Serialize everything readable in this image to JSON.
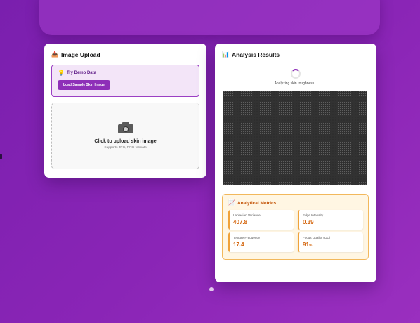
{
  "upload": {
    "title": "Image Upload",
    "title_icon": "upload-tray-icon",
    "demo": {
      "title": "Try Demo Data",
      "title_icon": "lightbulb-icon",
      "button_label": "Load Sample Skin Image"
    },
    "dropzone": {
      "icon": "camera-icon",
      "title": "Click to upload skin image",
      "subtitle": "Supports JPG, PNG formats"
    }
  },
  "results": {
    "title": "Analysis Results",
    "title_icon": "bar-chart-icon",
    "status_text": "Analyzing skin roughness...",
    "metrics": {
      "title": "Analytical Metrics",
      "title_icon": "trend-chart-icon",
      "items": [
        {
          "label": "Laplacian Variance",
          "value": "407.8",
          "unit": ""
        },
        {
          "label": "Edge Intensity",
          "value": "0.39",
          "unit": ""
        },
        {
          "label": "Texture Frequency",
          "value": "17.4",
          "unit": ""
        },
        {
          "label": "Focus Quality (QC)",
          "value": "91",
          "unit": "%"
        }
      ]
    }
  },
  "colors": {
    "accent": "#8e2fb8",
    "metric_value": "#d4660e",
    "background": "#8a25b6"
  }
}
